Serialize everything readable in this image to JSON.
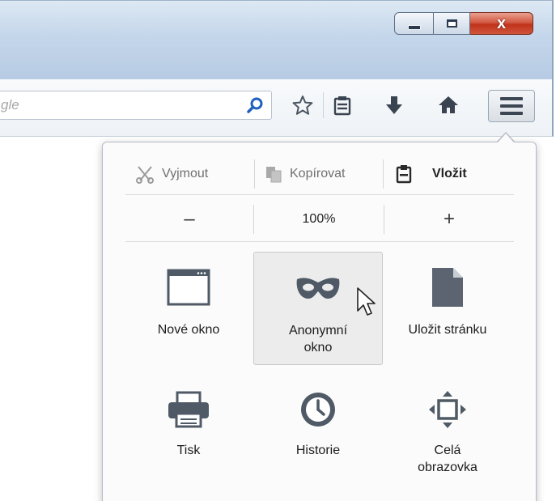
{
  "window": {
    "caption_buttons": {
      "minimize_icon": "minimize-icon",
      "maximize_icon": "maximize-icon",
      "close_glyph": "x"
    }
  },
  "toolbar": {
    "search": {
      "placeholder": "gle",
      "go_icon": "magnifier-icon"
    },
    "icons": [
      "bookmark-star-icon",
      "reading-list-icon",
      "download-arrow-icon",
      "home-icon"
    ],
    "menu_icon": "hamburger-icon"
  },
  "menu_panel": {
    "edit_controls": {
      "cut": "Vyjmout",
      "copy": "Kopírovat",
      "paste": "Vložit"
    },
    "zoom_controls": {
      "minus": "–",
      "level": "100%",
      "plus": "+"
    },
    "items": [
      {
        "label": "Nové okno",
        "icon": "new-window-icon"
      },
      {
        "label": "Anonymní okno",
        "icon": "private-mask-icon"
      },
      {
        "label": "Uložit stránku",
        "icon": "save-page-icon"
      },
      {
        "label": "Tisk",
        "icon": "printer-icon"
      },
      {
        "label": "Historie",
        "icon": "history-clock-icon"
      },
      {
        "label": "Celá obrazovka",
        "icon": "fullscreen-arrows-icon"
      }
    ]
  },
  "colors": {
    "accent_blue": "#2060c0",
    "close_red": "#c0331c",
    "panel_bg": "#fbfbfb",
    "hover_bg": "#ececec"
  }
}
